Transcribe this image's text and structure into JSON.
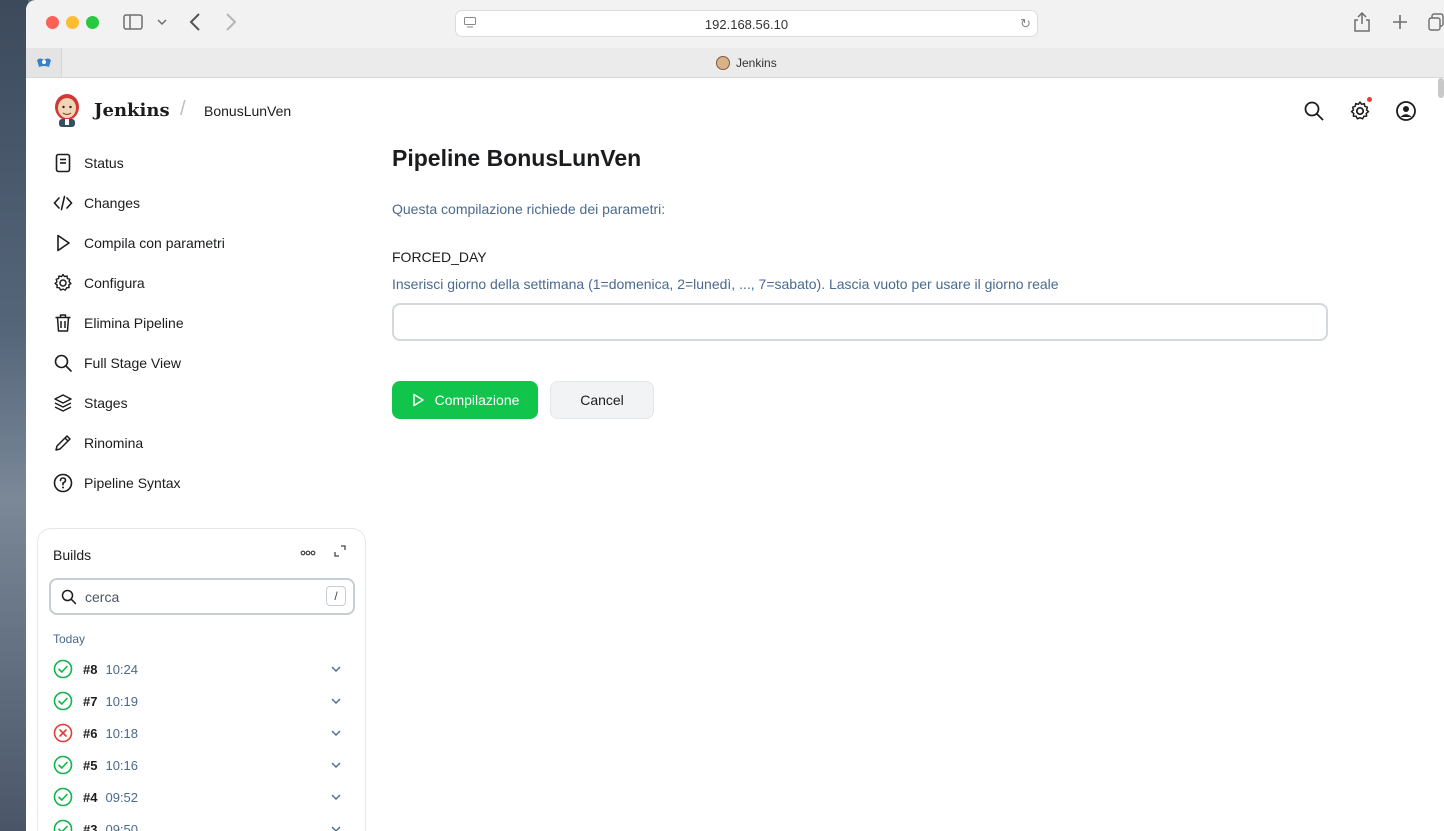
{
  "browser": {
    "url": "192.168.56.10",
    "tab_title": "Jenkins"
  },
  "header": {
    "app_name": "Jenkins",
    "breadcrumb_sep": "/",
    "breadcrumb": "BonusLunVen"
  },
  "sidebar": {
    "items": [
      {
        "label": "Status",
        "icon": "notepad-icon"
      },
      {
        "label": "Changes",
        "icon": "code-icon"
      },
      {
        "label": "Compila con parametri",
        "icon": "play-icon"
      },
      {
        "label": "Configura",
        "icon": "gear-icon"
      },
      {
        "label": "Elimina Pipeline",
        "icon": "trash-icon"
      },
      {
        "label": "Full Stage View",
        "icon": "search-icon"
      },
      {
        "label": "Stages",
        "icon": "layers-icon"
      },
      {
        "label": "Rinomina",
        "icon": "pencil-icon"
      },
      {
        "label": "Pipeline Syntax",
        "icon": "help-icon"
      }
    ]
  },
  "builds": {
    "title": "Builds",
    "search_placeholder": "cerca",
    "shortcut_key": "/",
    "group_label": "Today",
    "rows": [
      {
        "number": "#8",
        "time": "10:24",
        "status": "success"
      },
      {
        "number": "#7",
        "time": "10:19",
        "status": "success"
      },
      {
        "number": "#6",
        "time": "10:18",
        "status": "failed"
      },
      {
        "number": "#5",
        "time": "10:16",
        "status": "success"
      },
      {
        "number": "#4",
        "time": "09:52",
        "status": "success"
      },
      {
        "number": "#3",
        "time": "09:50",
        "status": "success"
      }
    ]
  },
  "main": {
    "title": "Pipeline BonusLunVen",
    "subtitle": "Questa compilazione richiede dei parametri:",
    "param_name": "FORCED_DAY",
    "param_description": "Inserisci giorno della settimana (1=domenica, 2=lunedì, ..., 7=sabato). Lascia vuoto per usare il giorno reale",
    "param_value": "",
    "build_button": "Compilazione",
    "cancel_button": "Cancel"
  },
  "colors": {
    "accent_green": "#10c44c",
    "failure_red": "#e63b3b",
    "muted_blue": "#4a6a8e"
  }
}
